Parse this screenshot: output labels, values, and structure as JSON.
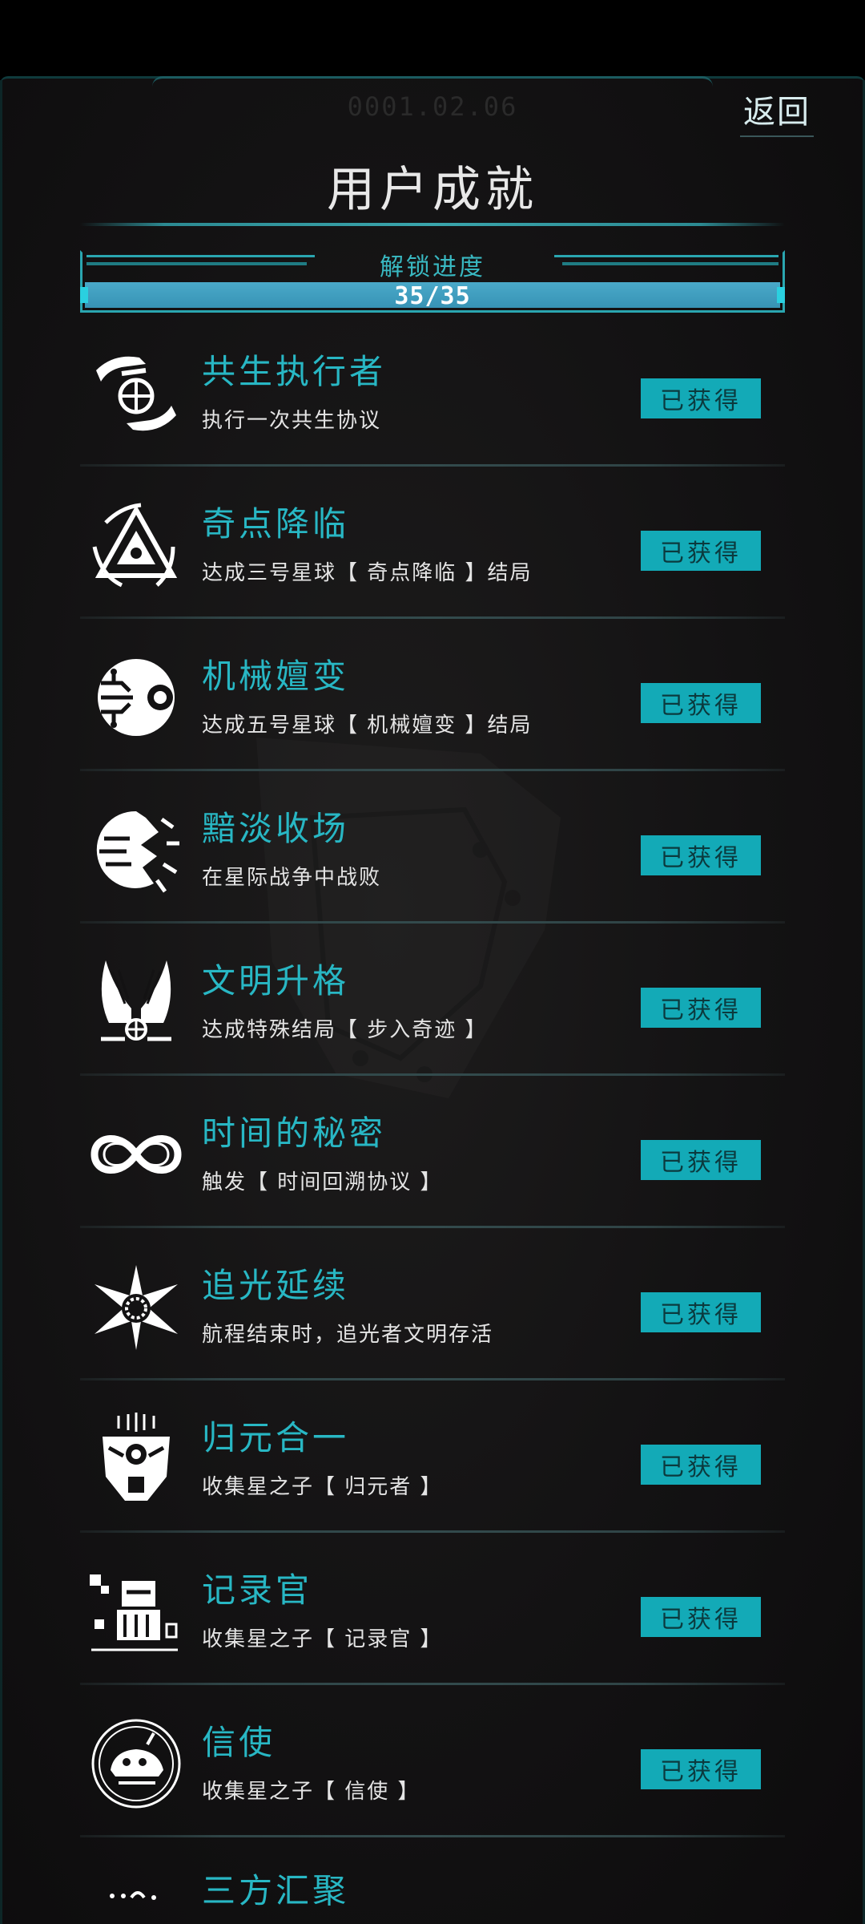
{
  "header": {
    "date": "0001.02.06",
    "back_label": "返回",
    "title": "用户成就"
  },
  "progress": {
    "label": "解锁进度",
    "value_text": "35/35",
    "unlocked": 35,
    "total": 35,
    "fraction": 1.0
  },
  "colors": {
    "accent": "#28b7c4",
    "badge_bg": "#13aab7",
    "badge_text": "#0b3a3e",
    "progress_fill": "#4aa9c9",
    "background": "#131213"
  },
  "achievements": [
    {
      "title": "共生执行者",
      "desc": "执行一次共生协议",
      "status": "已获得",
      "icon": "hands-globe-icon"
    },
    {
      "title": "奇点降临",
      "desc": "达成三号星球【 奇点降临 】结局",
      "status": "已获得",
      "icon": "triangle-eye-icon"
    },
    {
      "title": "机械嬗变",
      "desc": "达成五号星球【 机械嬗变 】结局",
      "status": "已获得",
      "icon": "circuit-eye-icon"
    },
    {
      "title": "黯淡收场",
      "desc": "在星际战争中战败",
      "status": "已获得",
      "icon": "broken-planet-icon"
    },
    {
      "title": "文明升格",
      "desc": "达成特殊结局【 步入奇迹 】",
      "status": "已获得",
      "icon": "winged-emblem-icon"
    },
    {
      "title": "时间的秘密",
      "desc": "触发【 时间回溯协议 】",
      "status": "已获得",
      "icon": "infinity-icon"
    },
    {
      "title": "追光延续",
      "desc": "航程结束时，追光者文明存活",
      "status": "已获得",
      "icon": "radiant-star-icon"
    },
    {
      "title": "归元合一",
      "desc": "收集星之子【 归元者 】",
      "status": "已获得",
      "icon": "mask-face-icon"
    },
    {
      "title": "记录官",
      "desc": "收集星之子【 记录官 】",
      "status": "已获得",
      "icon": "robot-recorder-icon"
    },
    {
      "title": "信使",
      "desc": "收集星之子【 信使 】",
      "status": "已获得",
      "icon": "messenger-orb-icon"
    }
  ],
  "peek_item": {
    "title": "三方汇聚"
  }
}
